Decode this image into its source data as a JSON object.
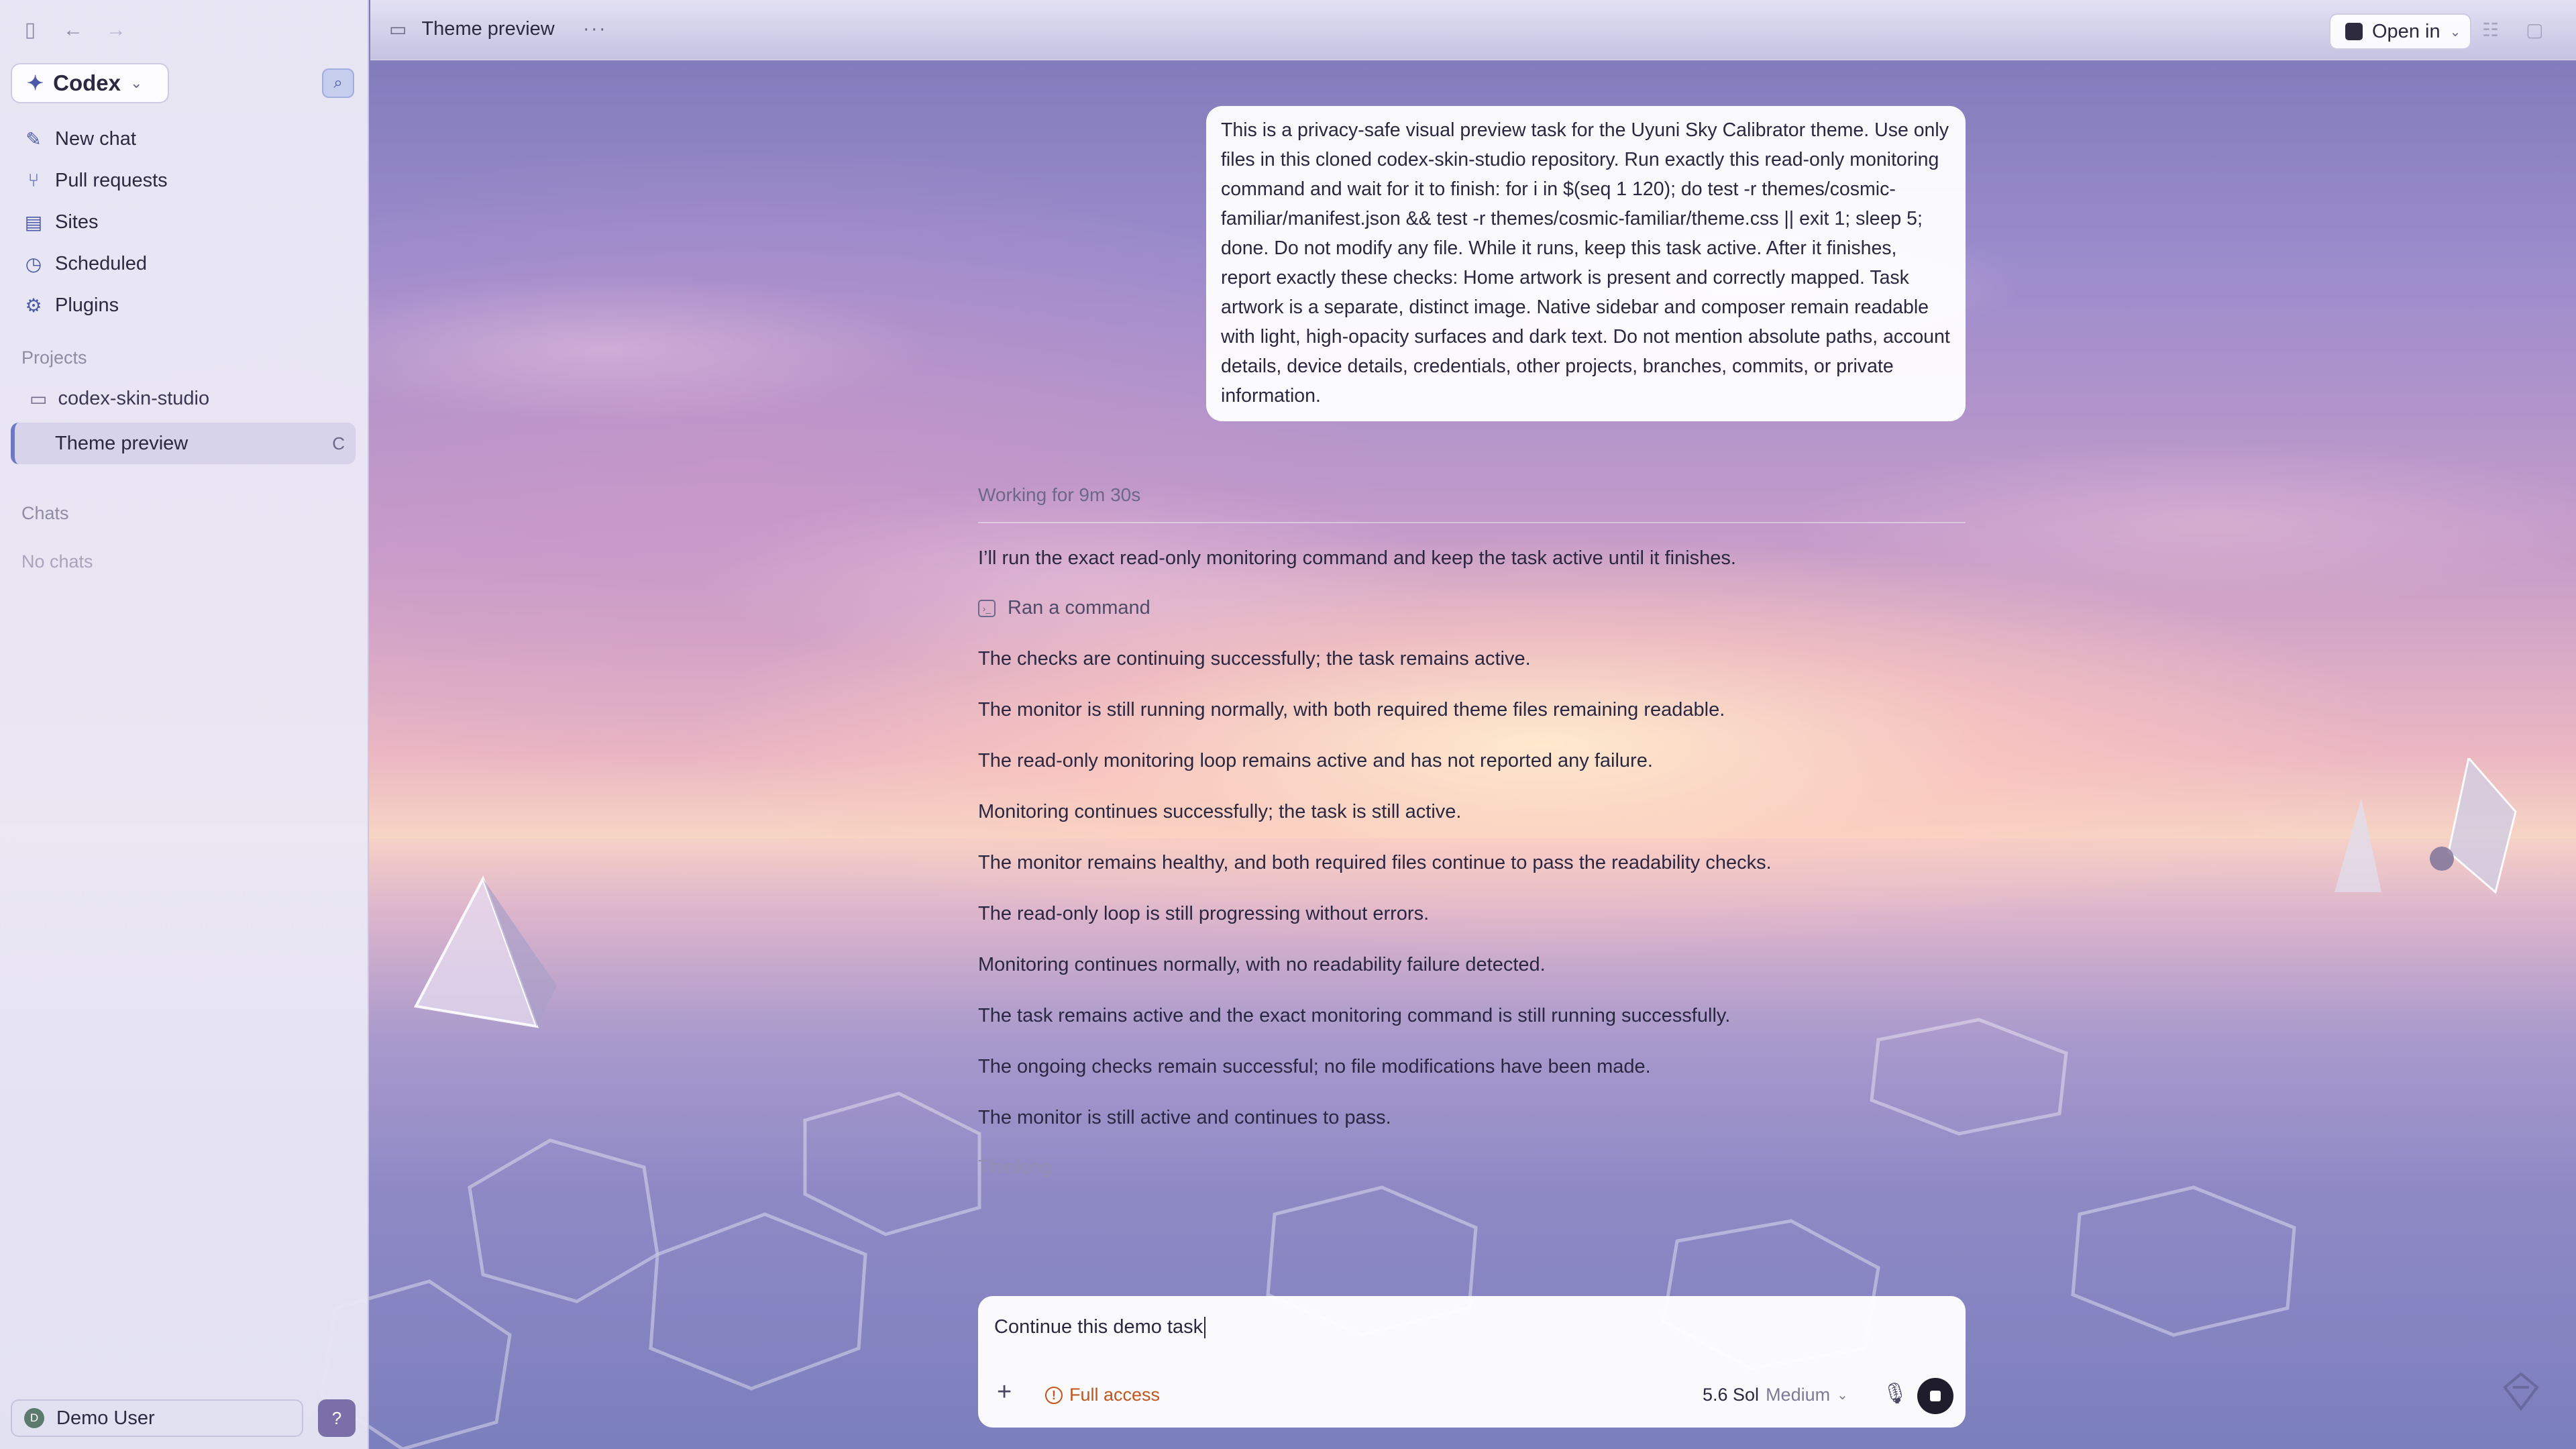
{
  "theme": {
    "accent": "#6e78c7",
    "warning": "#c2551c",
    "sidebar_bg": "#eceaf6"
  },
  "sidebar": {
    "app_name": "Codex",
    "nav": [
      {
        "label": "New chat",
        "icon": "compose-icon"
      },
      {
        "label": "Pull requests",
        "icon": "pull-request-icon"
      },
      {
        "label": "Sites",
        "icon": "sites-icon"
      },
      {
        "label": "Scheduled",
        "icon": "clock-icon"
      },
      {
        "label": "Plugins",
        "icon": "plugin-icon"
      }
    ],
    "projects_label": "Projects",
    "project_name": "codex-skin-studio",
    "active_chat": "Theme preview",
    "active_status": "C",
    "chats_label": "Chats",
    "no_chats": "No chats",
    "user_name": "Demo User",
    "user_initial": "D"
  },
  "topbar": {
    "title": "Theme preview",
    "more": "···",
    "open_in": "Open in"
  },
  "chat": {
    "user_message": "This is a privacy-safe visual preview task for the Uyuni Sky Calibrator theme. Use only files in this cloned codex-skin-studio repository. Run exactly this read-only monitoring command and wait for it to finish: for i in $(seq 1 120); do test -r themes/cosmic-familiar/manifest.json && test -r themes/cosmic-familiar/theme.css || exit 1; sleep 5; done. Do not modify any file. While it runs, keep this task active. After it finishes, report exactly these checks: Home artwork is present and correctly mapped. Task artwork is a separate, distinct image. Native sidebar and composer remain readable with light, high-opacity surfaces and dark text. Do not mention absolute paths, account details, device details, credentials, other projects, branches, commits, or private information.",
    "working": "Working for 9m 30s",
    "intro": "I’ll run the exact read-only monitoring command and keep the task active until it finishes.",
    "ran_command": "Ran a command",
    "updates": [
      "The checks are continuing successfully; the task remains active.",
      "The monitor is still running normally, with both required theme files remaining readable.",
      "The read-only monitoring loop remains active and has not reported any failure.",
      "Monitoring continues successfully; the task is still active.",
      "The monitor remains healthy, and both required files continue to pass the readability checks.",
      "The read-only loop is still progressing without errors.",
      "Monitoring continues normally, with no readability failure detected.",
      "The task remains active and the exact monitoring command is still running successfully.",
      "The ongoing checks remain successful; no file modifications have been made.",
      "The monitor is still active and continues to pass."
    ],
    "thinking": "Thinking"
  },
  "composer": {
    "value": "Continue this demo task",
    "plus": "+",
    "access": "Full access",
    "model": "5.6 Sol",
    "effort": "Medium"
  }
}
